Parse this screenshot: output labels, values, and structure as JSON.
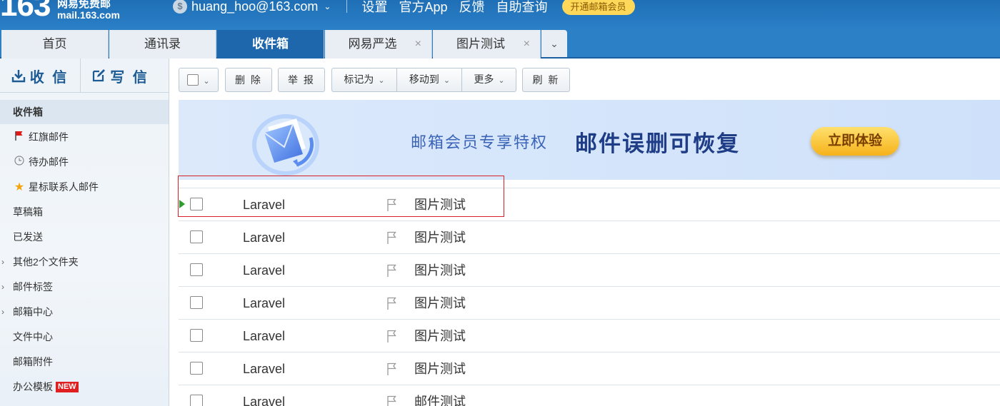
{
  "header": {
    "logo_number": "163",
    "logo_cn": "网易免费邮",
    "logo_domain": "mail.163.com",
    "user_email": "huang_hoo@163.com",
    "links": [
      "设置",
      "官方App",
      "反馈",
      "自助查询"
    ],
    "vip_button": "开通邮箱会员"
  },
  "tabs": [
    {
      "label": "首页"
    },
    {
      "label": "通讯录"
    },
    {
      "label": "收件箱",
      "active": true
    },
    {
      "label": "网易严选",
      "closable": true
    },
    {
      "label": "图片测试",
      "closable": true
    }
  ],
  "sidebar": {
    "receive_label": "收 信",
    "write_label": "写 信",
    "folders": [
      {
        "label": "收件箱",
        "active": true
      },
      {
        "label": "红旗邮件",
        "icon": "red-flag-icon"
      },
      {
        "label": "待办邮件",
        "icon": "clock-icon"
      },
      {
        "label": "星标联系人邮件",
        "icon": "star-icon"
      },
      {
        "label": "草稿箱"
      },
      {
        "label": "已发送"
      },
      {
        "label": "其他2个文件夹",
        "expandable": true
      },
      {
        "label": "邮件标签",
        "expandable": true
      },
      {
        "label": "邮箱中心",
        "expandable": true
      },
      {
        "label": "文件中心"
      },
      {
        "label": "邮箱附件"
      },
      {
        "label": "办公模板",
        "badge": "NEW"
      }
    ]
  },
  "toolbar": {
    "delete": "删 除",
    "report": "举 报",
    "mark_as": "标记为",
    "move_to": "移动到",
    "more": "更多",
    "refresh": "刷 新"
  },
  "banner": {
    "subtitle": "邮箱会员专享特权",
    "headline": "邮件误删可恢复",
    "button": "立即体验"
  },
  "mails": [
    {
      "sender": "Laravel",
      "subject": "图片测试",
      "current": true
    },
    {
      "sender": "Laravel",
      "subject": "图片测试"
    },
    {
      "sender": "Laravel",
      "subject": "图片测试"
    },
    {
      "sender": "Laravel",
      "subject": "图片测试"
    },
    {
      "sender": "Laravel",
      "subject": "图片测试"
    },
    {
      "sender": "Laravel",
      "subject": "图片测试"
    },
    {
      "sender": "Laravel",
      "subject": "邮件测试"
    }
  ],
  "colors": {
    "header_blue": "#2a7fc6",
    "active_tab": "#1e67ac",
    "highlight_red": "#d8202a",
    "new_badge": "#e02020",
    "vip_gold": "#ffd85a"
  }
}
